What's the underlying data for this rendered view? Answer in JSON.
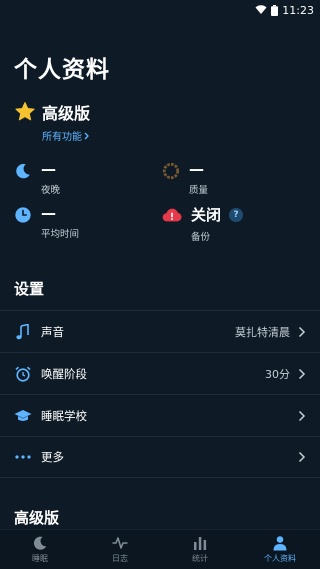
{
  "status_bar": {
    "time": "11:23"
  },
  "page_title": "个人资料",
  "premium": {
    "title": "高级版",
    "link": "所有功能"
  },
  "stats": {
    "nights": {
      "value": "—",
      "label": "夜晚"
    },
    "quality": {
      "value": "—",
      "label": "质量"
    },
    "average_time": {
      "value": "—",
      "label": "平均时间"
    },
    "backup": {
      "value": "关闭",
      "label": "备份",
      "help": "?"
    }
  },
  "settings": {
    "title": "设置",
    "items": [
      {
        "label": "声音",
        "value": "莫扎特清晨",
        "icon": "music-note-icon"
      },
      {
        "label": "唤醒阶段",
        "value": "30分",
        "icon": "alarm-clock-icon"
      },
      {
        "label": "睡眠学校",
        "value": "",
        "icon": "graduation-cap-icon"
      },
      {
        "label": "更多",
        "value": "",
        "icon": "more-dots-icon"
      }
    ]
  },
  "premium_section": {
    "title": "高级版"
  },
  "tabs": [
    {
      "label": "睡眠",
      "icon": "moon-icon",
      "active": false
    },
    {
      "label": "日志",
      "icon": "waveform-icon",
      "active": false
    },
    {
      "label": "统计",
      "icon": "bar-chart-icon",
      "active": false
    },
    {
      "label": "个人资料",
      "icon": "person-icon",
      "active": true
    }
  ],
  "colors": {
    "background": "#0e1b26",
    "accent": "#5fb4ff",
    "star": "#f5c12e",
    "alert": "#e8394b"
  }
}
